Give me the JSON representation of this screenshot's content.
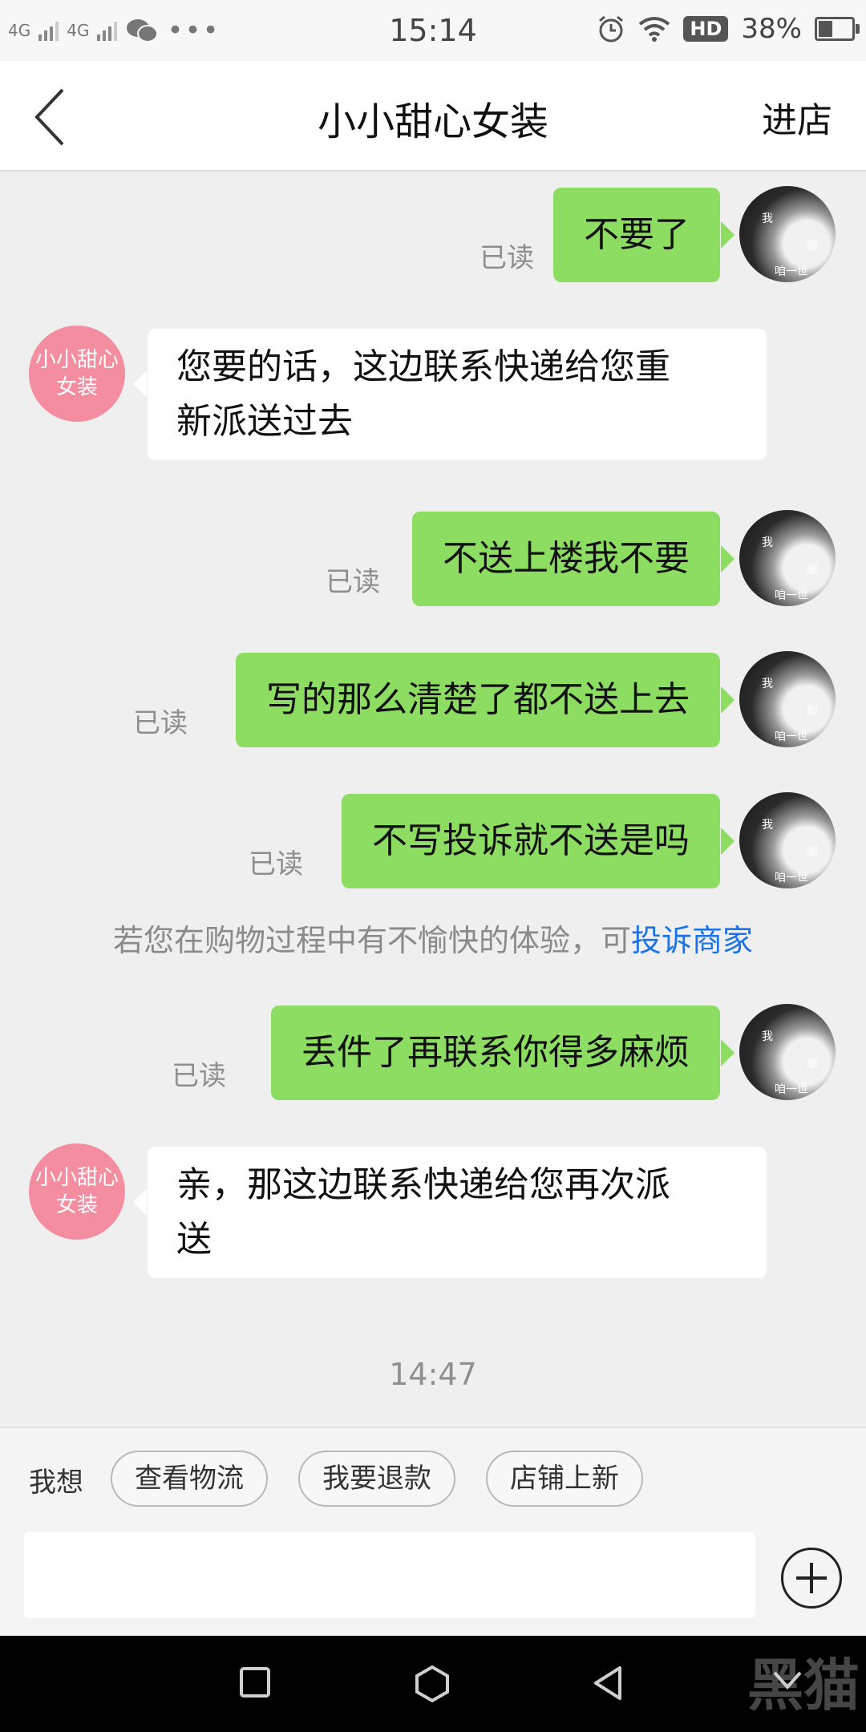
{
  "status_bar": {
    "network1": "4G",
    "network2": "4G",
    "time": "15:14",
    "hd": "HD",
    "battery": "38%"
  },
  "header": {
    "title": "小小甜心女装",
    "enter_store": "进店"
  },
  "shop_avatar": {
    "line1": "小小甜心",
    "line2": "女装"
  },
  "me_avatar_text": {
    "t1": "我",
    "t2": "鄙",
    "t3": "咱一世"
  },
  "messages": [
    {
      "from": "me",
      "text": "不要了",
      "read": "已读"
    },
    {
      "from": "shop",
      "line1": "您要的话，这边联系快递给您重",
      "line2": "新派送过去"
    },
    {
      "from": "me",
      "text": "不送上楼我不要",
      "read": "已读"
    },
    {
      "from": "me",
      "text": "写的那么清楚了都不送上去",
      "read": "已读"
    },
    {
      "from": "me",
      "text": "不写投诉就不送是吗",
      "read": "已读"
    },
    {
      "from": "me",
      "text": "丢件了再联系你得多麻烦",
      "read": "已读"
    },
    {
      "from": "shop",
      "line1": "亲，那这边联系快递给您再次派",
      "line2": "送"
    }
  ],
  "notice": {
    "text": "若您在购物过程中有不愉快的体验，可",
    "link": "投诉商家"
  },
  "timestamp": "14:47",
  "quick_replies": {
    "label": "我想",
    "chips": [
      "查看物流",
      "我要退款",
      "店铺上新"
    ]
  },
  "input": {
    "placeholder": ""
  },
  "watermark": "黑猫"
}
